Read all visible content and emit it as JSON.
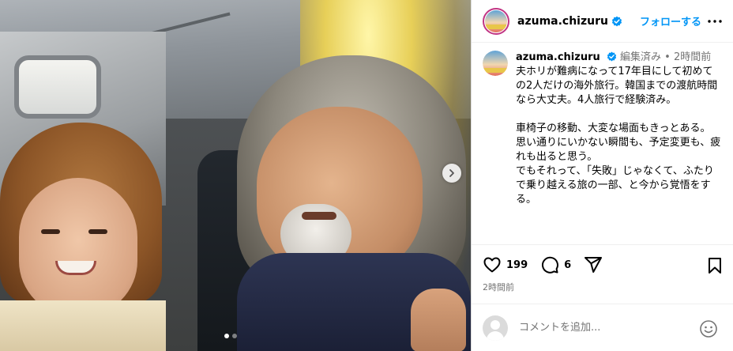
{
  "post": {
    "username": "azuma.chizuru",
    "follow_label": "フォローする",
    "caption_meta": "編集済み • 2時間前",
    "caption_text": "夫ホリが難病になって17年目にして初めての2人だけの海外旅行。韓国までの渡航時間なら大丈夫。4人旅行で経験済み。\n\n車椅子の移動、大変な場面もきっとある。\n思い通りにいかない瞬間も、予定変更も、疲れも出ると思う。\nでもそれって、「失敗」じゃなくて、ふたりで乗り越える旅の一部、と今から覚悟をする。",
    "likes": "199",
    "comments": "6",
    "timestamp": "2時間前",
    "comment_placeholder": "コメントを追加...",
    "carousel": {
      "total": 2,
      "current": 1
    }
  },
  "colors": {
    "accent": "#0095f6",
    "verified": "#0095f6",
    "meta_text": "#737373",
    "border": "#dbdbdb"
  },
  "icons": {
    "more": "more-horizontal-icon",
    "like": "heart-icon",
    "comment": "comment-icon",
    "share": "share-icon",
    "save": "bookmark-icon",
    "emoji": "emoji-icon",
    "next": "chevron-right-icon"
  }
}
